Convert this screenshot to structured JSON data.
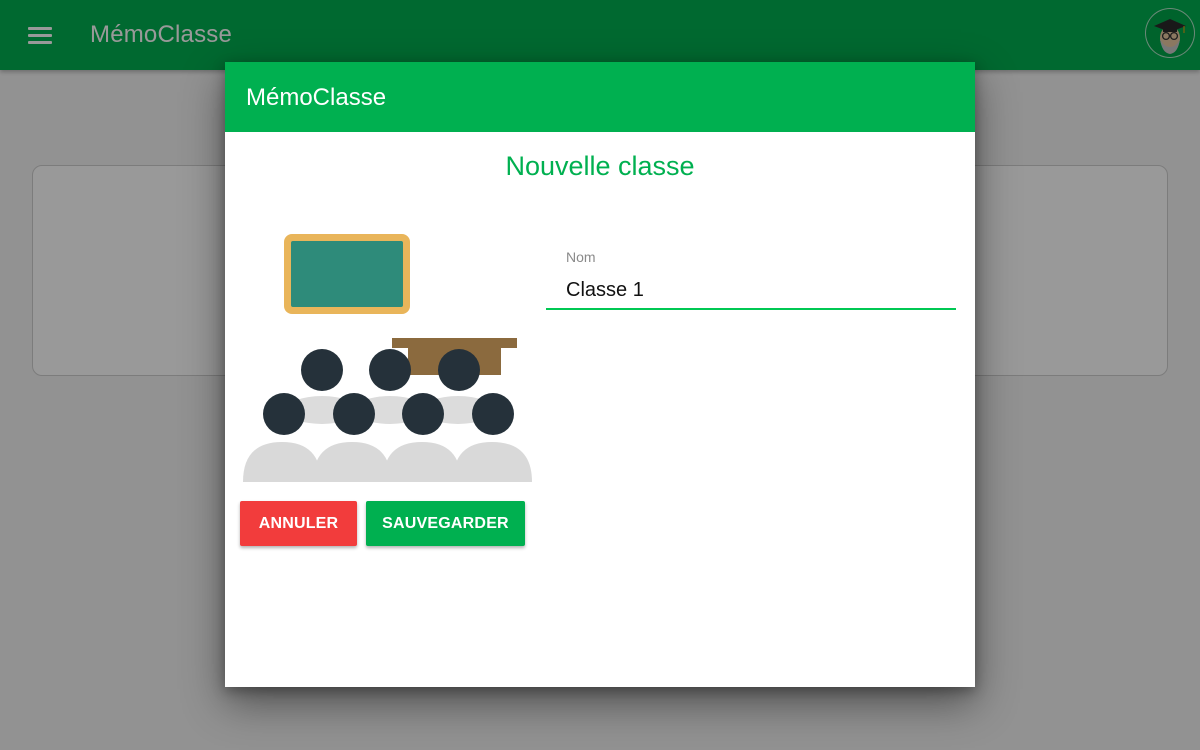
{
  "app_bar": {
    "title": "MémoClasse",
    "menu_icon": "hamburger-menu-icon",
    "avatar_icon": "graduate-avatar-icon",
    "color": "#00b050"
  },
  "dialog": {
    "header_title": "MémoClasse",
    "heading": "Nouvelle classe",
    "illustration_icon": "classroom-illustration-icon",
    "form": {
      "name_label": "Nom",
      "name_value": "Classe 1"
    },
    "buttons": {
      "cancel_label": "ANNULER",
      "save_label": "SAUVEGARDER"
    }
  },
  "colors": {
    "primary": "#00b050",
    "danger": "#f23c3c",
    "input_underline": "#00c853"
  }
}
